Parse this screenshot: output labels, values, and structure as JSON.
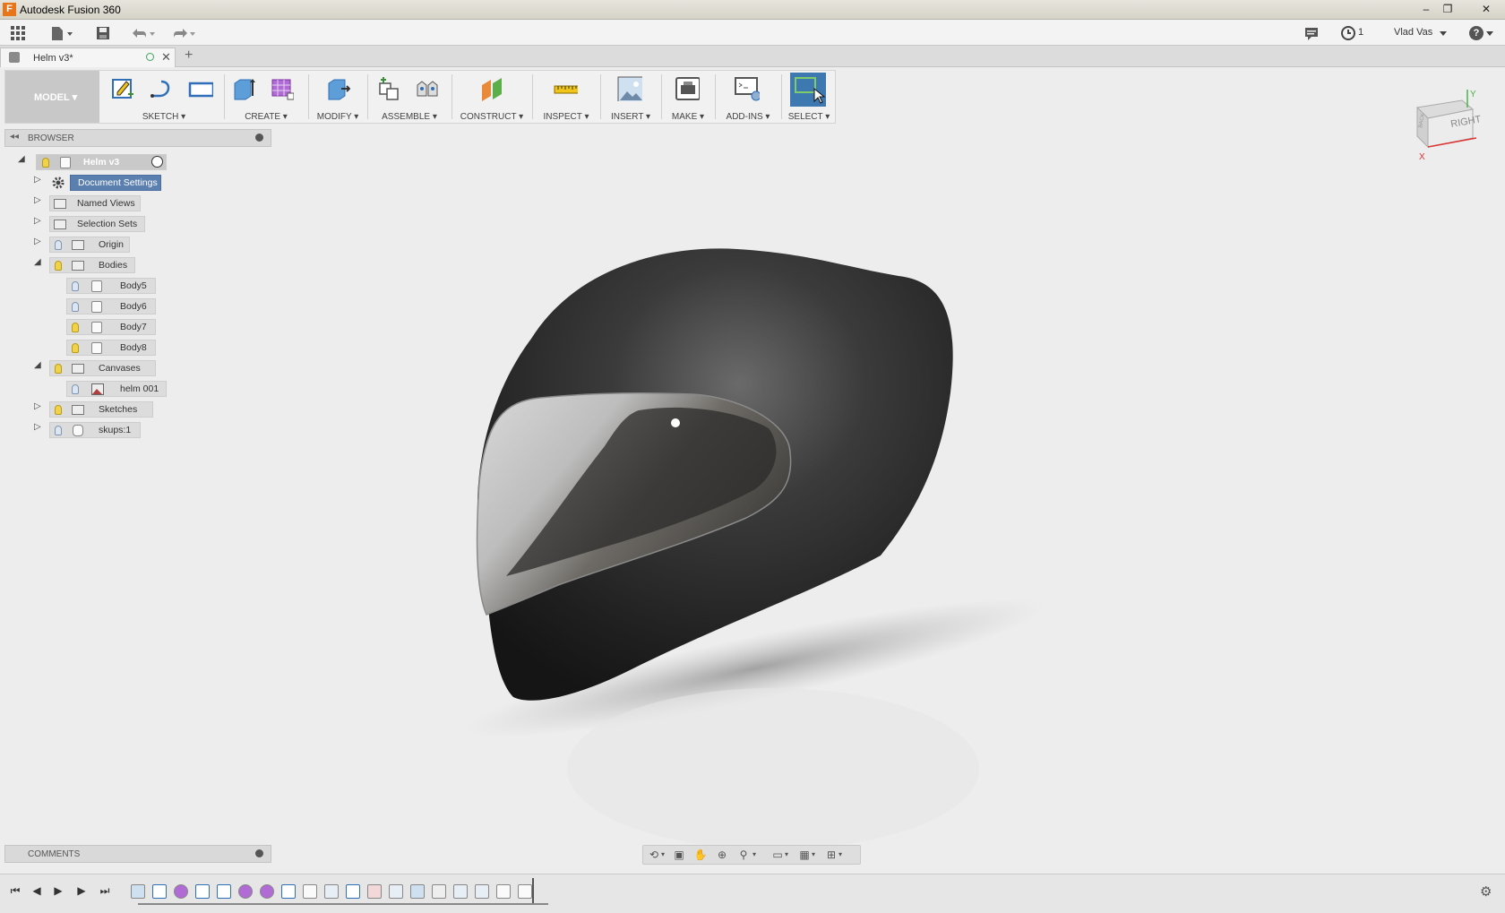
{
  "window": {
    "title": "Autodesk Fusion 360",
    "minimize": "–",
    "maximize": "❐",
    "close": "✕"
  },
  "appbar": {
    "user": "Vlad Vas",
    "jobs_count": "1",
    "help": "?"
  },
  "tabs": [
    {
      "label": "Helm v3*"
    }
  ],
  "toolbar": {
    "workspace": "MODEL ▾",
    "groups": [
      "SKETCH ▾",
      "CREATE ▾",
      "MODIFY ▾",
      "ASSEMBLE ▾",
      "CONSTRUCT ▾",
      "INSPECT ▾",
      "INSERT ▾",
      "MAKE ▾",
      "ADD-INS ▾",
      "SELECT ▾"
    ]
  },
  "browser": {
    "title": "BROWSER",
    "root": "Helm v3",
    "items": [
      {
        "label": "Document Settings"
      },
      {
        "label": "Named Views"
      },
      {
        "label": "Selection Sets"
      },
      {
        "label": "Origin"
      },
      {
        "label": "Bodies"
      },
      {
        "label": "Body5"
      },
      {
        "label": "Body6"
      },
      {
        "label": "Body7"
      },
      {
        "label": "Body8"
      },
      {
        "label": "Canvases"
      },
      {
        "label": "helm 001"
      },
      {
        "label": "Sketches"
      },
      {
        "label": "skups:1"
      }
    ]
  },
  "viewcube": {
    "face_right": "RIGHT",
    "face_back": "BACK",
    "axis_x": "X",
    "axis_y": "Y"
  },
  "comments": {
    "title": "COMMENTS"
  },
  "colors": {
    "accent": "#5b7fae",
    "select_active": "#3d78b1"
  }
}
